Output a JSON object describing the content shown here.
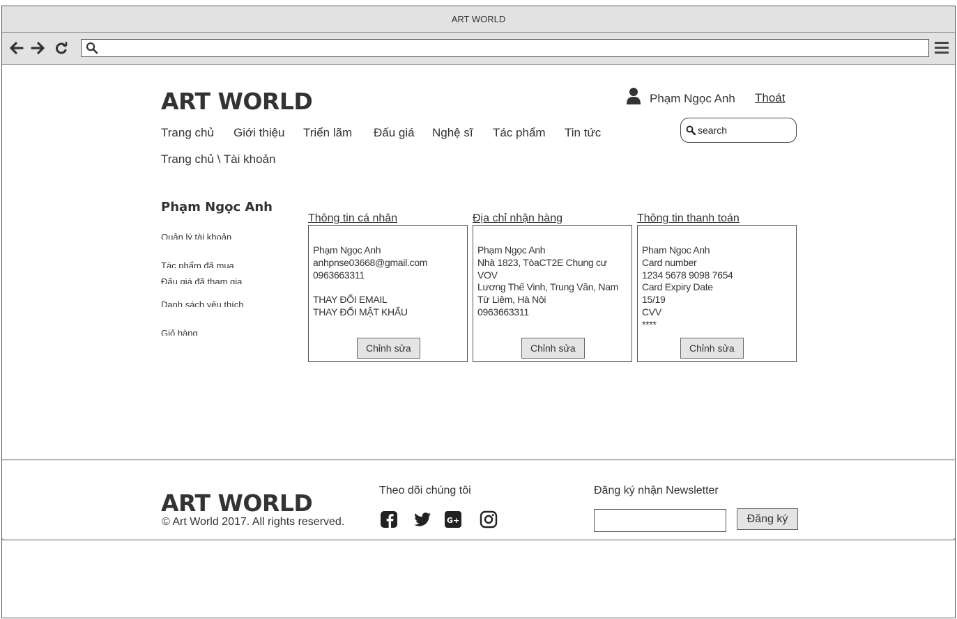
{
  "browser": {
    "title": "ART WORLD",
    "url": "",
    "nav": {
      "back_icon": "arrow-left-icon",
      "forward_icon": "arrow-right-icon",
      "reload_icon": "reload-icon",
      "menu_icon": "hamburger-menu-icon"
    }
  },
  "header": {
    "brand": "ART WORLD",
    "user_name": "Phạm Ngọc Anh",
    "logout": "Thoát",
    "search_placeholder": "search"
  },
  "nav": {
    "items": [
      "Trang chủ",
      "Giới thiệu",
      "Triển lãm",
      "Đấu giá",
      "Nghệ sĩ",
      "Tác phẩm",
      "Tin tức"
    ]
  },
  "breadcrumb": "Trang chủ \\ Tài khoản",
  "sidebar": {
    "title": "Phạm Ngọc Anh",
    "items": [
      "Quản lý tài khoản",
      "Tác phẩm đã mua",
      "Đấu giá đã tham gia",
      "Danh sách yêu thích",
      "Giỏ hàng"
    ]
  },
  "cards": [
    {
      "heading": "Thông tin cá nhân",
      "lines": [
        "Phạm Ngọc Anh",
        "anhpnse03668@gmail.com",
        "0963663311",
        "",
        "THAY ĐỔI EMAIL",
        "THAY ĐỔI MẬT KHẨU"
      ],
      "button": "Chỉnh sửa"
    },
    {
      "heading": "Địa chỉ nhận hàng",
      "lines": [
        "Phạm Ngọc Anh",
        "Nhà 1823, TòaCT2E Chung cư",
        "VOV",
        "Lương Thế Vinh, Trung Văn, Nam",
        "Từ Liêm, Hà Nội",
        "0963663311"
      ],
      "button": "Chỉnh sửa"
    },
    {
      "heading": "Thông tin thanh toán",
      "lines": [
        "Pham Ngoc Anh",
        "Card number",
        "1234 5678 9098 7654",
        "Card Expiry Date",
        "15/19",
        "CVV",
        "****"
      ],
      "button": "Chỉnh sửa"
    }
  ],
  "footer": {
    "brand": "ART WORLD",
    "copyright": "© Art World 2017. All rights reserved.",
    "follow_title": "Theo dõi chúng tôi",
    "social": [
      "facebook-icon",
      "twitter-icon",
      "google-plus-icon",
      "instagram-icon"
    ],
    "newsletter_title": "Đăng ký nhận Newsletter",
    "newsletter_value": "",
    "subscribe_button": "Đăng ký"
  }
}
